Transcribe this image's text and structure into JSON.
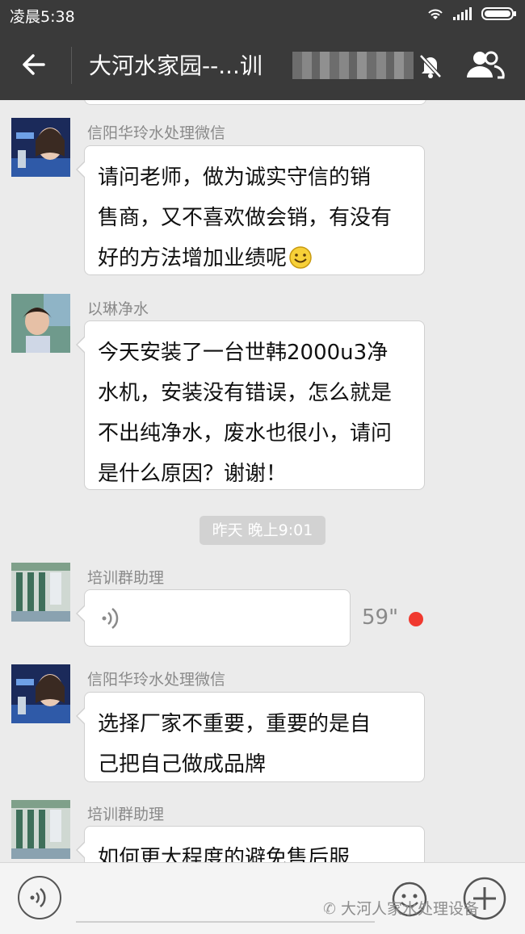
{
  "status_bar": {
    "time": "凌晨5:38"
  },
  "header": {
    "title": "大河水家园--...训",
    "icons": [
      "back-arrow-icon",
      "mute-bell-icon",
      "group-members-icon"
    ]
  },
  "messages": [
    {
      "sender": "信阳华玲水处理微信",
      "type": "text",
      "lines": [
        "请问老师，做为诚实守信的销",
        "售商，又不喜欢做会销，有没有",
        "好的方法增加业绩呢"
      ],
      "emoji": "smile-emoji"
    },
    {
      "sender": "以琳净水",
      "type": "text",
      "lines": [
        "今天安装了一台世韩2000u3净",
        "水机，安装没有错误，怎么就是",
        "不出纯净水，废水也很小，请问",
        "是什么原因？谢谢！"
      ]
    },
    {
      "sender": "培训群助理",
      "type": "voice",
      "duration": "59\"",
      "unread": true
    },
    {
      "sender": "信阳华玲水处理微信",
      "type": "text",
      "lines": [
        "选择厂家不重要，重要的是自",
        "己把自己做成品牌"
      ]
    },
    {
      "sender": "培训群助理",
      "type": "text",
      "lines": [
        "如何更大程度的避免售后服"
      ]
    }
  ],
  "timestamp": "昨天 晚上9:01",
  "input_bar": {
    "watermark": "大河人家水处理设备"
  },
  "colors": {
    "bar": "#3a3a3a",
    "background": "#ebebeb",
    "unread_dot": "#f0392f"
  }
}
